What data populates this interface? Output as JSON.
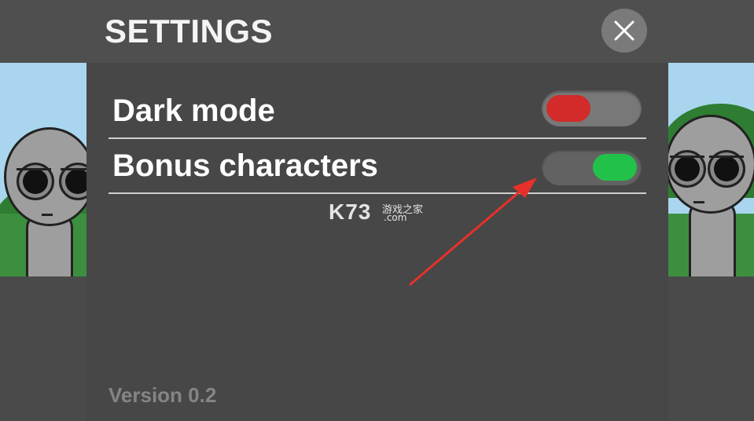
{
  "header": {
    "title": "SETTINGS",
    "close_icon": "close-icon"
  },
  "settings": {
    "items": [
      {
        "label": "Dark mode",
        "state": "off",
        "knob_color": "#d32a2a"
      },
      {
        "label": "Bonus characters",
        "state": "on",
        "knob_color": "#22c24a"
      }
    ]
  },
  "footer": {
    "version": "Version 0.2"
  },
  "watermark": {
    "brand": "K73",
    "sub": "游戏之家",
    "domain": ".com"
  },
  "colors": {
    "background": "#4a4a4a",
    "panel": "#474747",
    "divider": "#cfcfcf",
    "annotation_arrow": "#e8302a"
  }
}
